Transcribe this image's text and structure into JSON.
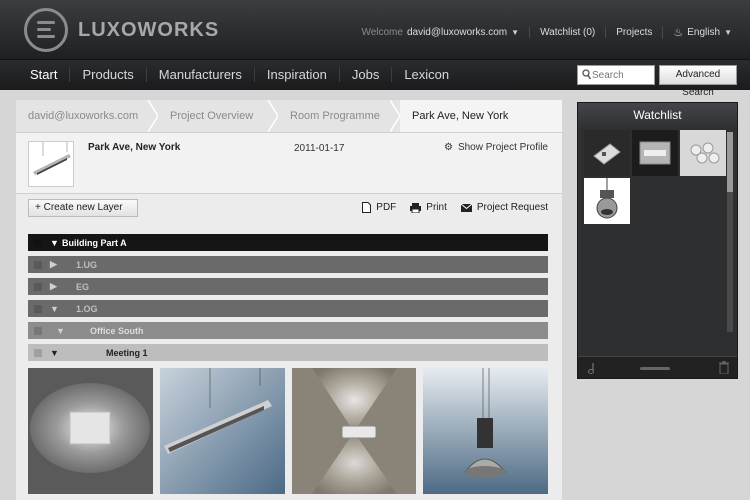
{
  "header": {
    "logo_text": "LUXOWORKS",
    "welcome_label": "Welcome",
    "user_email": "david@luxoworks.com",
    "watchlist_link": "Watchlist (0)",
    "projects_link": "Projects",
    "language": "English"
  },
  "nav": {
    "items": [
      "Start",
      "Products",
      "Manufacturers",
      "Inspiration",
      "Jobs",
      "Lexicon"
    ],
    "search_placeholder": "Search",
    "advanced_search": "Advanced Search"
  },
  "breadcrumb": [
    "david@luxoworks.com",
    "Project Overview",
    "Room Programme",
    "Park Ave, New York"
  ],
  "project": {
    "name": "Park Ave, New York",
    "date": "2011-01-17",
    "profile_link": "Show Project Profile"
  },
  "toolbar": {
    "new_layer": "+ Create new Layer",
    "pdf": "PDF",
    "print": "Print",
    "request": "Project Request"
  },
  "tree": [
    {
      "label": "Building Part A",
      "expanded": true,
      "level": 0
    },
    {
      "label": "1.UG",
      "expanded": false,
      "level": 1
    },
    {
      "label": "EG",
      "expanded": false,
      "level": 1
    },
    {
      "label": "1.OG",
      "expanded": true,
      "level": 1
    },
    {
      "label": "Office South",
      "expanded": true,
      "level": 2
    },
    {
      "label": "Meeting 1",
      "expanded": true,
      "level": 3
    }
  ],
  "watchlist": {
    "title": "Watchlist"
  },
  "colors": {
    "header_bg": "#2b2c2f",
    "panel_bg": "#ececec",
    "row_dark": "#151515"
  }
}
